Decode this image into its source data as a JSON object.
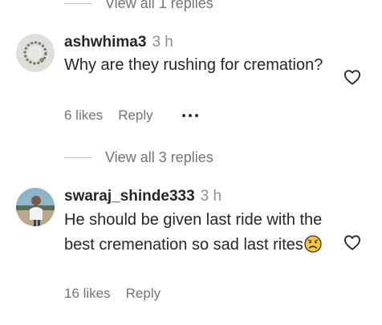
{
  "top_replies": {
    "label": "View all 1 replies"
  },
  "comments": [
    {
      "username": "ashwhima3",
      "time": "3 h",
      "text": "Why are they rushing for cremation?",
      "likes": "6 likes",
      "reply_label": "Reply",
      "more_icon": "more-horizontal-icon",
      "like_icon": "heart-outline-icon"
    },
    {
      "username": "swaraj_shinde333",
      "time": "3 h",
      "text": "He should be given last ride with the best cremenation so sad last rites",
      "emoji": "sad-face-emoji",
      "likes": "16 likes",
      "reply_label": "Reply",
      "like_icon": "heart-outline-icon"
    }
  ],
  "mid_replies": {
    "label": "View all 3 replies"
  },
  "colors": {
    "text": "#262626",
    "muted": "#737373",
    "timestamp": "#8e8e8e"
  }
}
